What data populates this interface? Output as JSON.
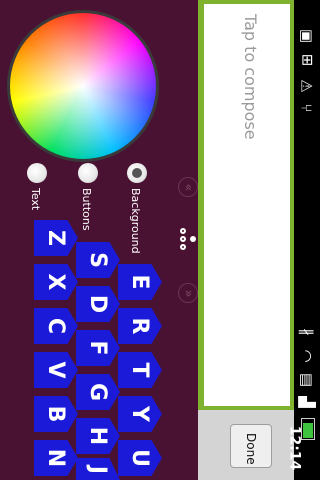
{
  "compose": {
    "placeholder": "Tap to compose",
    "done_label": "Done"
  },
  "status": {
    "time": "12:14",
    "battery_level": 0.85
  },
  "options": [
    {
      "label": "Background",
      "selected": true
    },
    {
      "label": "Buttons",
      "selected": false
    },
    {
      "label": "Text",
      "selected": false
    }
  ],
  "keys": {
    "row1": [
      "E",
      "R",
      "T",
      "Y",
      "U"
    ],
    "row2": [
      "S",
      "D",
      "F",
      "G",
      "H",
      "J"
    ],
    "row3": [
      "Z",
      "X",
      "C",
      "V",
      "B",
      "N"
    ]
  },
  "colors": {
    "background": "#4a1232",
    "key": "#1a1ad8",
    "compose_border": "#7fb22e"
  },
  "icons": [
    "color-wheel",
    "signal-icon",
    "wifi-icon",
    "battery-icon",
    "usb-icon",
    "warning-icon",
    "lock-icon",
    "sd-card-icon"
  ]
}
